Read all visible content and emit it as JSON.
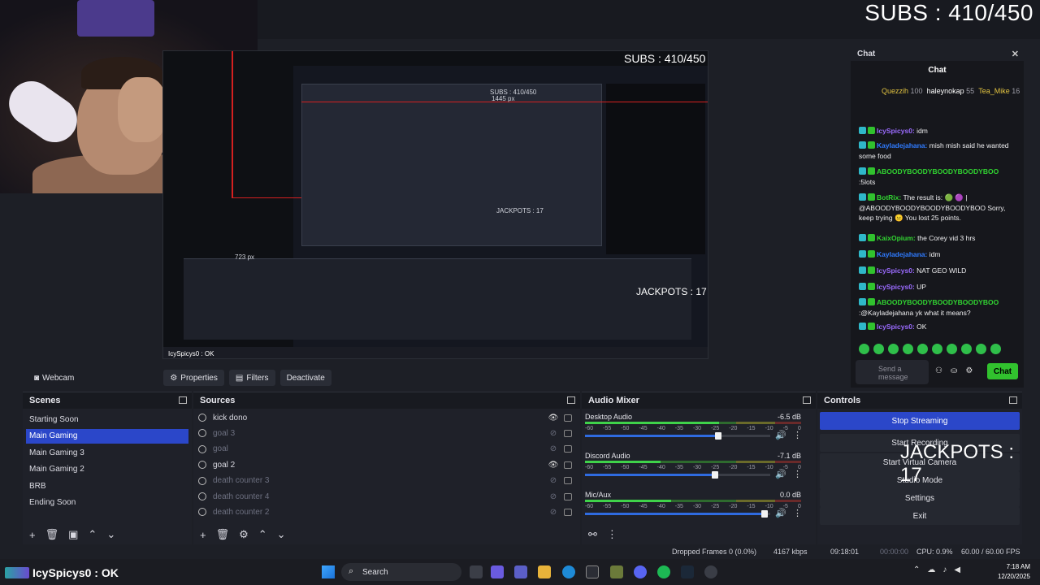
{
  "overlay": {
    "subs_counter": "SUBS : 410/450",
    "jackpots": "JACKPOTS : 17"
  },
  "preview": {
    "subs_counter": "SUBS : 410/450",
    "inner_subs": "SUBS : 410/450",
    "inner_px_h": "1445 px",
    "inner_px_w": "723 px",
    "inner_jackpots": "JACKPOTS : 17",
    "jackpots_mid": "JACKPOTS : 17",
    "chat_line": "IcySpicys0 : OK"
  },
  "source_toolbar": {
    "source_name": "Webcam",
    "properties": "Properties",
    "filters": "Filters",
    "deactivate": "Deactivate"
  },
  "scenes": {
    "title": "Scenes",
    "items": [
      "Starting Soon",
      "Main Gaming",
      "Main Gaming 3",
      "Main Gaming 2",
      "BRB",
      "Ending Soon"
    ],
    "active_index": 1
  },
  "sources": {
    "title": "Sources",
    "items": [
      {
        "name": "kick dono",
        "visible": true
      },
      {
        "name": "goal 3",
        "visible": false
      },
      {
        "name": "goal",
        "visible": false
      },
      {
        "name": "goal 2",
        "visible": true
      },
      {
        "name": "death counter 3",
        "visible": false
      },
      {
        "name": "death counter 4",
        "visible": false
      },
      {
        "name": "death counter 2",
        "visible": false
      }
    ]
  },
  "mixer": {
    "title": "Audio Mixer",
    "scale": [
      "-60",
      "-55",
      "-50",
      "-45",
      "-40",
      "-35",
      "-30",
      "-25",
      "-20",
      "-15",
      "-10",
      "-5",
      "0"
    ],
    "channels": [
      {
        "name": "Desktop Audio",
        "db": "-6.5 dB",
        "level": 0.62,
        "fader": 0.72
      },
      {
        "name": "Discord Audio",
        "db": "-7.1 dB",
        "level": 0.35,
        "fader": 0.7
      },
      {
        "name": "Mic/Aux",
        "db": "0.0 dB",
        "level": 0.4,
        "fader": 0.97
      }
    ]
  },
  "controls": {
    "title": "Controls",
    "stop_streaming": "Stop Streaming",
    "start_recording": "Start Recording",
    "start_virtual_camera": "Start Virtual Camera",
    "studio_mode": "Studio Mode",
    "settings": "Settings",
    "exit": "Exit"
  },
  "status": {
    "dropped_frames": "Dropped Frames 0 (0.0%)",
    "bitrate": "4167 kbps",
    "stream_time": "09:18:01",
    "rec_time": "00:00:00",
    "cpu": "CPU: 0.9%",
    "fps": "60.00 / 60.00 FPS"
  },
  "chat": {
    "panel_title": "Chat",
    "header": "Chat",
    "leaderboard": [
      {
        "name": "Quezzih",
        "points": "100"
      },
      {
        "name": "haleynokap",
        "points": "55"
      },
      {
        "name": "Tea_Mike",
        "points": "16"
      }
    ],
    "messages": [
      {
        "user": "IcySpicys0:",
        "text": " idm",
        "color": "#9b6bff"
      },
      {
        "user": "Kayladejahana:",
        "text": " mish mish said he wanted some food",
        "color": "#2f7bff"
      },
      {
        "user": "ABOODYBOODYBOODYBOODYBOO",
        "text": " :5lots",
        "color": "#31d431"
      },
      {
        "user": "BotRix:",
        "text": " The result is: 🟢 🟣 | @ABOODYBOODYBOODYBOODYBOO Sorry, keep trying 😐 You lost 25 points.",
        "color": "#31d431"
      },
      {
        "user": "KaixOpium:",
        "text": " the Corey vid 3 hrs",
        "color": "#31d431"
      },
      {
        "user": "Kayladejahana:",
        "text": " idm",
        "color": "#2f7bff"
      },
      {
        "user": "IcySpicys0:",
        "text": " NAT GEO WILD",
        "color": "#9b6bff"
      },
      {
        "user": "IcySpicys0:",
        "text": " UP",
        "color": "#9b6bff"
      },
      {
        "user": "ABOODYBOODYBOODYBOODYBOO",
        "text": " :@Kayladejahana yk what it means?",
        "color": "#31d431"
      },
      {
        "user": "IcySpicys0:",
        "text": " OK",
        "color": "#9b6bff"
      }
    ],
    "input_placeholder": "Send a message",
    "send_label": "Chat"
  },
  "taskbar": {
    "latest_chat": "IcySpicys0 : OK",
    "search_label": "Search",
    "time": "7:18 AM",
    "date": "12/20/2025"
  },
  "colors": {
    "accent": "#2b47c9",
    "kick_green": "#31c22e",
    "red_line": "#d42020"
  }
}
